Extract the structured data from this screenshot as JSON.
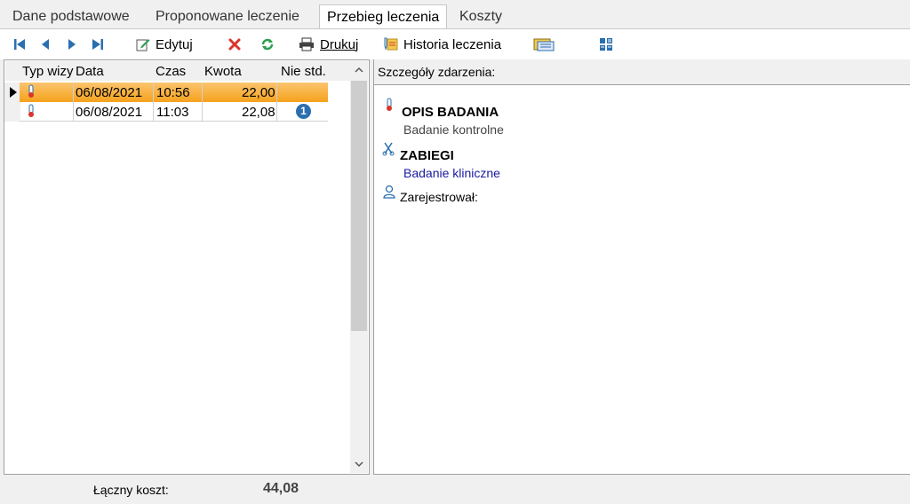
{
  "tabs": [
    {
      "label": "Dane podstawowe",
      "active": false
    },
    {
      "label": "Proponowane leczenie",
      "active": false
    },
    {
      "label": "Przebieg leczenia",
      "active": true
    },
    {
      "label": "Koszty",
      "active": false
    }
  ],
  "toolbar": {
    "first_icon": "first-record-icon",
    "prev_icon": "prev-record-icon",
    "next_icon": "next-record-icon",
    "last_icon": "last-record-icon",
    "edit_label": "Edytuj",
    "print_label": "Drukuj",
    "history_label": "Historia leczenia"
  },
  "grid": {
    "columns": [
      "Typ wizy",
      "Data",
      "Czas",
      "Kwota",
      "Nie std."
    ],
    "rows": [
      {
        "date": "06/08/2021",
        "time": "10:56",
        "amount": "22,00",
        "nonstd": "",
        "selected": true
      },
      {
        "date": "06/08/2021",
        "time": "11:03",
        "amount": "22,08",
        "nonstd": "1",
        "selected": false
      }
    ]
  },
  "details": {
    "header": "Szczegóły zdarzenia:",
    "exam_title": "OPIS BADANIA",
    "exam_desc": "Badanie kontrolne",
    "proc_title": "ZABIEGI",
    "proc_desc": "Badanie kliniczne",
    "registered_label": "Zarejestrował:"
  },
  "footer": {
    "total_label": "Łączny koszt:",
    "total_value": "44,08"
  },
  "colors": {
    "selected_row": "#f5a21c",
    "link_blue": "#1a1aa0",
    "badge_blue": "#2a6fb0",
    "delete_red": "#d9342b",
    "refresh_green": "#2e9e4e"
  }
}
